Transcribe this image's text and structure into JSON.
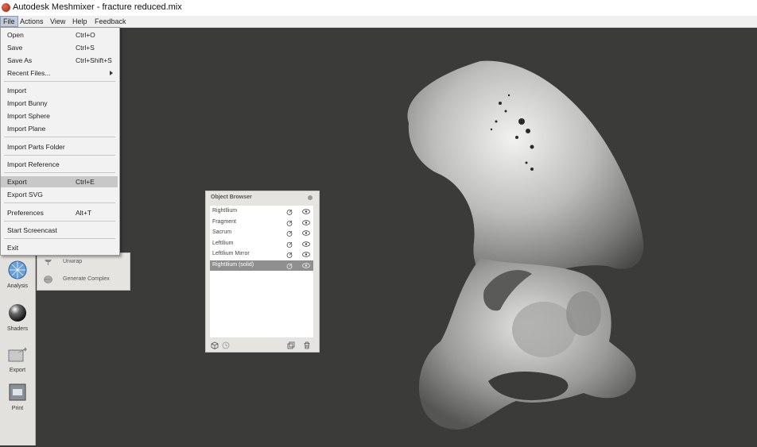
{
  "window": {
    "title": "Autodesk Meshmixer - fracture reduced.mix"
  },
  "menubar": [
    "File",
    "Actions",
    "View",
    "Help",
    "Feedback"
  ],
  "file_menu": [
    {
      "label": "Open",
      "shortcut": "Ctrl+O"
    },
    {
      "label": "Save",
      "shortcut": "Ctrl+S"
    },
    {
      "label": "Save As",
      "shortcut": "Ctrl+Shift+S"
    },
    {
      "label": "Recent Files...",
      "shortcut": ""
    },
    {
      "label": "Import",
      "shortcut": ""
    },
    {
      "label": "Import Bunny",
      "shortcut": ""
    },
    {
      "label": "Import Sphere",
      "shortcut": ""
    },
    {
      "label": "Import Plane",
      "shortcut": ""
    },
    {
      "label": "Import Parts Folder",
      "shortcut": ""
    },
    {
      "label": "Import Reference",
      "shortcut": ""
    },
    {
      "label": "Export",
      "shortcut": "Ctrl+E"
    },
    {
      "label": "Export SVG",
      "shortcut": ""
    },
    {
      "label": "Preferences",
      "shortcut": "Alt+T"
    },
    {
      "label": "Start Screencast",
      "shortcut": ""
    },
    {
      "label": "Exit",
      "shortcut": ""
    }
  ],
  "toolbar": [
    {
      "label": "Analysis",
      "icon": "analysis-icon"
    },
    {
      "label": "Shaders",
      "icon": "shaders-icon"
    },
    {
      "label": "Export",
      "icon": "export-icon"
    },
    {
      "label": "Print",
      "icon": "print-icon"
    }
  ],
  "submenu": [
    {
      "label": "Unwrap",
      "icon": "unwrap-icon"
    },
    {
      "label": "Generate Complex",
      "icon": "generate-complex-icon"
    }
  ],
  "object_browser": {
    "title": "Object Browser",
    "items": [
      "RightIlium",
      "Fragment",
      "Sacrum",
      "LeftIlium",
      "LeftIlium Mirror",
      "RightIlium (solid)"
    ],
    "selected_index": 5
  },
  "colors": {
    "viewport": "#3b3b39",
    "panel": "#e6e4e0",
    "selection": "#8f8f8f"
  }
}
